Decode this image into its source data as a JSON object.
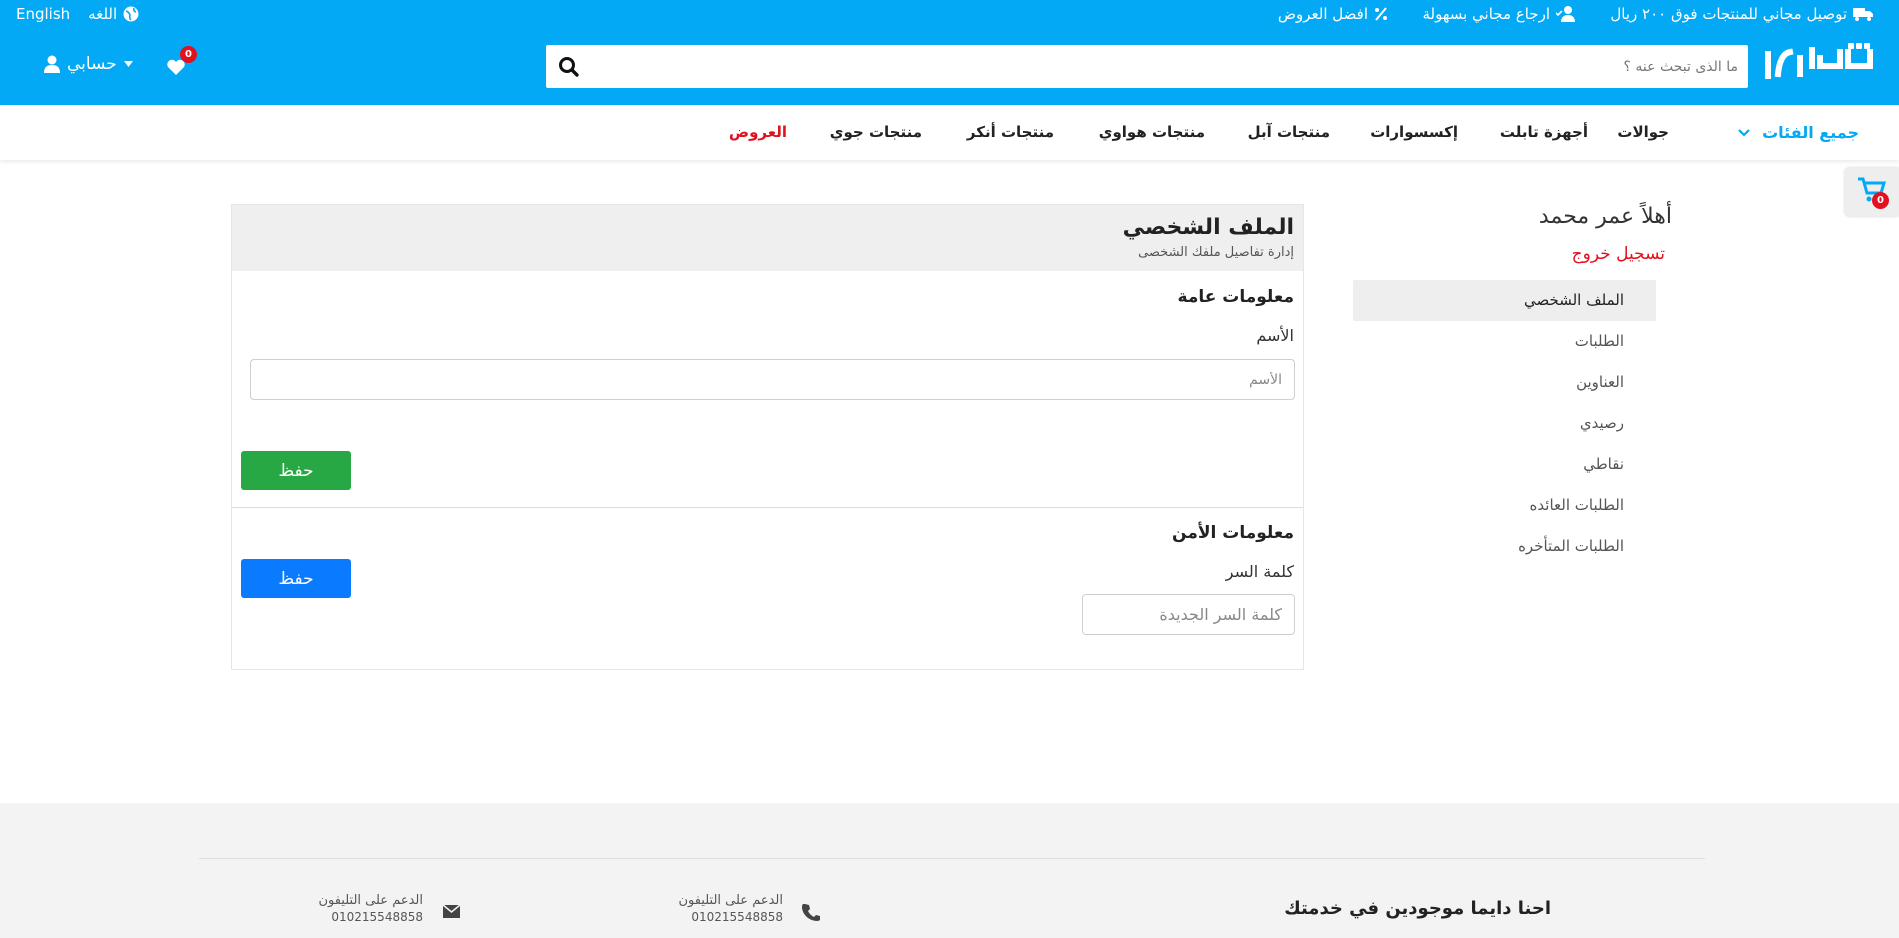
{
  "topbar": {
    "promo_shipping": "توصيل مجاني للمنتجات فوق ٢٠٠ ريال",
    "promo_return": "ارجاع مجاني بسهولة",
    "promo_offers": "افضل العروض",
    "lang_label": "اللغه",
    "lang_switch": "English"
  },
  "header": {
    "search_placeholder": "ما الذى تبحث عنه ؟",
    "wishlist_count": "0",
    "account_label": "حسابي"
  },
  "nav": {
    "all_categories": "جميع الفئات",
    "items": [
      "جوالات",
      "أجهزة تابلت",
      "إكسسوارات",
      "منتجات آبل",
      "منتجات هواوي",
      "منتجات أنكر",
      "منتجات جوي"
    ],
    "offers": "العروض"
  },
  "cart": {
    "count": "0"
  },
  "sidebar": {
    "greeting": "أهلاً عمر محمد",
    "logout": "تسجيل خروج",
    "items": [
      "الملف الشخصي",
      "الطلبات",
      "العناوين",
      "رصيدي",
      "نقاطي",
      "الطلبات العائده",
      "الطلبات المتأخره"
    ]
  },
  "profile": {
    "title": "الملف الشخصي",
    "subtitle": "إدارة تفاصيل ملفك الشخصى",
    "general_title": "معلومات عامة",
    "name_label": "الأسم",
    "name_placeholder": "الأسم",
    "save_label": "حفظ",
    "security_title": "معلومات الأمن",
    "password_label": "كلمة السر",
    "password_placeholder": "كلمة السر الجديدة",
    "security_save_label": "حفظ"
  },
  "footer": {
    "title": "احنا دايما موجودين في خدمتك",
    "phone_label": "الدعم على التليفون",
    "phone_number": "010215548858",
    "email_label": "الدعم على التليفون",
    "email_number": "010215548858"
  },
  "colors": {
    "brand": "#03a9f4",
    "offers": "#e3101d",
    "save_green": "#28a745",
    "save_blue": "#0a7bff"
  }
}
